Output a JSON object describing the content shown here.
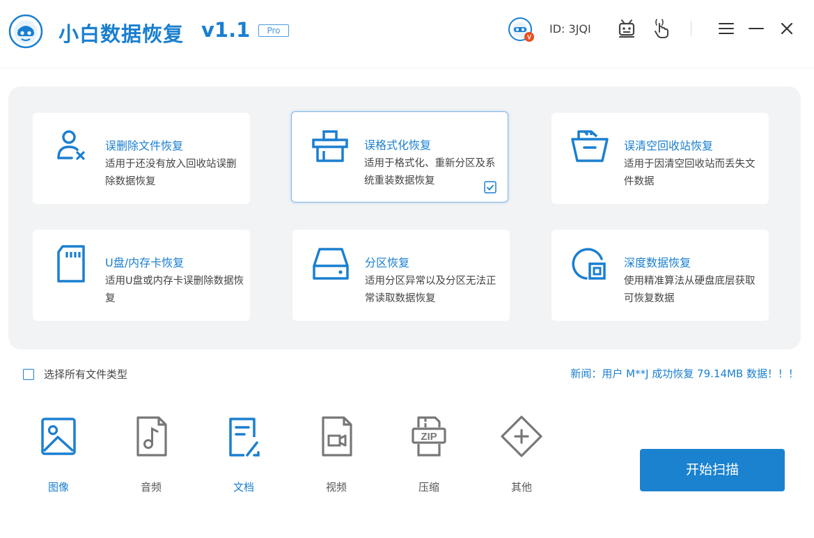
{
  "header": {
    "title": "小白数据恢复",
    "version": "v1.1",
    "badge": "Pro",
    "user_id": "ID: 3JQI",
    "icons": [
      "logo-icon",
      "avatar-icon",
      "robot-icon",
      "hand-pointer-icon",
      "menu-icon",
      "minimize-icon",
      "close-icon"
    ]
  },
  "modes": [
    {
      "title": "误删除文件恢复",
      "desc": "适用于还没有放入回收站误删除数据恢复",
      "icon": "user-delete-icon",
      "selected": false
    },
    {
      "title": "误格式化恢复",
      "desc": "适用于格式化、重新分区及系统重装数据恢复",
      "icon": "format-drive-icon",
      "selected": true
    },
    {
      "title": "误清空回收站恢复",
      "desc": "适用于因清空回收站而丢失文件数据",
      "icon": "recycle-bin-icon",
      "selected": false
    },
    {
      "title": "U盘/内存卡恢复",
      "desc": "适用U盘或内存卡误删除数据恢复",
      "icon": "sd-card-icon",
      "selected": false
    },
    {
      "title": "分区恢复",
      "desc": "适用分区异常以及分区无法正常读取数据恢复",
      "icon": "hard-disk-icon",
      "selected": false
    },
    {
      "title": "深度数据恢复",
      "desc": "使用精准算法从硬盘底层获取可恢复数据",
      "icon": "deep-scan-icon",
      "selected": false
    }
  ],
  "options": {
    "select_all": "选择所有文件类型",
    "news": "新闻：用户 M**J 成功恢复 79.14MB 数据！！！"
  },
  "file_types": [
    {
      "label": "图像",
      "icon": "image-icon",
      "active": true
    },
    {
      "label": "音频",
      "icon": "audio-icon",
      "active": false
    },
    {
      "label": "文档",
      "icon": "document-icon",
      "active": true
    },
    {
      "label": "视频",
      "icon": "video-icon",
      "active": false
    },
    {
      "label": "压缩",
      "icon": "zip-icon",
      "active": false
    },
    {
      "label": "其他",
      "icon": "other-icon",
      "active": false
    }
  ],
  "actions": {
    "start_scan": "开始扫描"
  },
  "colors": {
    "accent": "#1a7fd0",
    "button": "#1a82cf",
    "panel": "#f2f3f5",
    "inactive_icon": "#777777"
  }
}
